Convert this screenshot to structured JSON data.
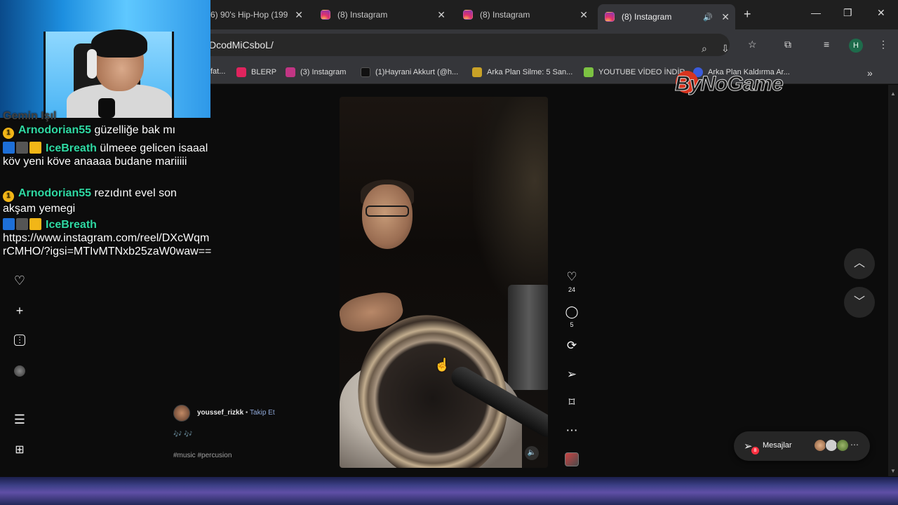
{
  "browser": {
    "tabs": [
      {
        "label": "6) 90's Hip-Hop (199",
        "close": "✕"
      },
      {
        "label": "(8) Instagram",
        "close": "✕"
      },
      {
        "label": "(8) Instagram",
        "close": "✕"
      },
      {
        "label": "(8) Instagram",
        "close": "✕",
        "active": true,
        "audio": "🔊"
      }
    ],
    "new_tab": "+",
    "window_controls": {
      "minimize": "—",
      "maximize": "❐",
      "close": "✕"
    },
    "address_url": "DcodMiCsboL/",
    "profile_initial": "H",
    "bookmarks": [
      {
        "label": "fat..."
      },
      {
        "label": "BLERP",
        "color": "#e0245e"
      },
      {
        "label": "(3) Instagram",
        "color": "#c13584"
      },
      {
        "label": "(1)Hayrani Akkurt (@h...",
        "color": "#111111"
      },
      {
        "label": "Arka Plan Silme: 5 San...",
        "color": "#c9a227"
      },
      {
        "label": "YOUTUBE VİDEO İNDİR",
        "color": "#7cc242"
      },
      {
        "label": "Arka Plan Kaldırma Ar...",
        "color": "#3b5bdb"
      }
    ],
    "bookmarks_overflow": "»"
  },
  "overlay": {
    "watermark": "ByNoGame",
    "chat": [
      {
        "partial": "Gemin Işıl"
      },
      {
        "badges": [
          "coin"
        ],
        "user": "Arnodorian55",
        "text": "güzelliğe bak mı"
      },
      {
        "badges": [
          "sq",
          "sq",
          "crown"
        ],
        "user": "IceBreath",
        "text": "ülmeee gelicen isaaal köv yeni köve anaaaa budane mariiiii"
      },
      {
        "badges": [
          "coin"
        ],
        "user": "Arnodorian55",
        "text": "rezıdınt evel son akşam yemegi"
      },
      {
        "badges": [
          "sq",
          "sq",
          "crown"
        ],
        "user": "IceBreath",
        "text": "https://www.instagram.com/reel/DXcWqmrCMHO/?igsi=MTIvMTNxb25zaW0waw=="
      }
    ]
  },
  "instagram": {
    "left_nav_icons": [
      "heart-icon",
      "create-icon",
      "insights-icon",
      "profile-icon",
      "menu-icon",
      "more-apps-icon"
    ],
    "reel": {
      "likes": "24",
      "comments": "5",
      "author": "youssef_rizkk",
      "separator": " • ",
      "follow_label": "Takip Et",
      "caption_emoji": "🎶 🎶",
      "hashtags": "#music #percusion"
    },
    "messages_label": "Mesajlar",
    "messages_badge": "8"
  },
  "colors": {
    "chat_username": "#2fd9a3",
    "instagram_bg": "#0c0c0c",
    "accent_follow": "#8fa8d8"
  }
}
